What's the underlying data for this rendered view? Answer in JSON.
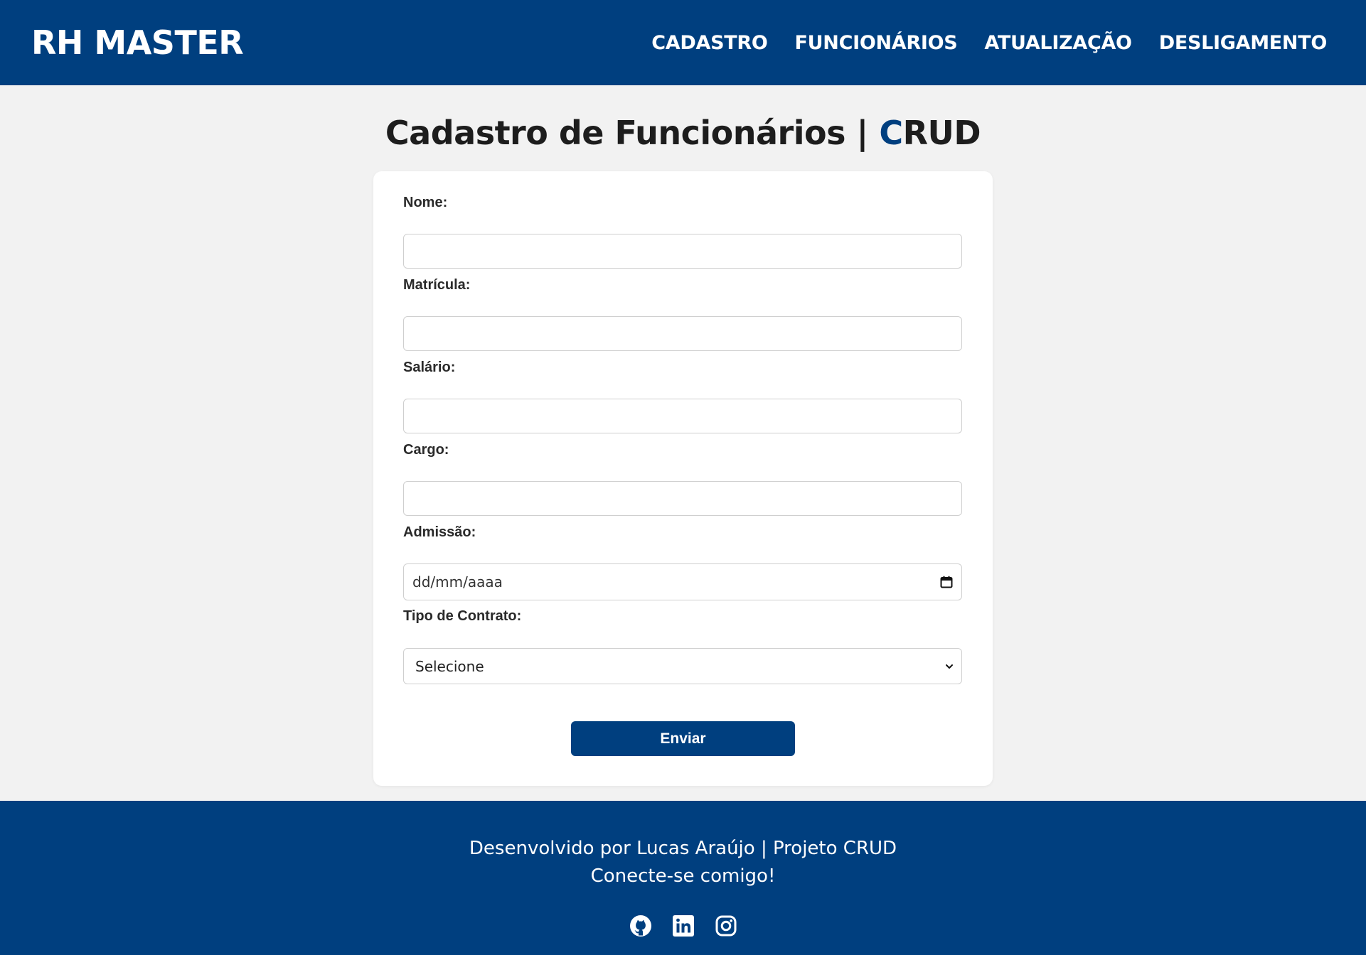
{
  "header": {
    "brand": "RH MASTER",
    "nav": [
      {
        "label": "CADASTRO"
      },
      {
        "label": "FUNCIONÁRIOS"
      },
      {
        "label": "ATUALIZAÇÃO"
      },
      {
        "label": "DESLIGAMENTO"
      }
    ]
  },
  "page": {
    "title_main": "Cadastro de Funcionários | ",
    "title_accent": "C",
    "title_rest": "RUD"
  },
  "form": {
    "nome_label": "Nome:",
    "nome_value": "",
    "matricula_label": "Matrícula:",
    "matricula_value": "",
    "salario_label": "Salário:",
    "salario_value": "",
    "cargo_label": "Cargo:",
    "cargo_value": "",
    "admissao_label": "Admissão:",
    "admissao_placeholder": "dd/mm/aaaa",
    "contrato_label": "Tipo de Contrato:",
    "contrato_selected": "Selecione",
    "submit_label": "Enviar"
  },
  "footer": {
    "line1": "Desenvolvido por Lucas Araújo | Projeto CRUD",
    "line2": "Conecte-se comigo!",
    "socials": [
      "github-icon",
      "linkedin-icon",
      "instagram-icon"
    ]
  },
  "colors": {
    "primary": "#003f7f",
    "background": "#f2f2f2",
    "card": "#ffffff"
  }
}
